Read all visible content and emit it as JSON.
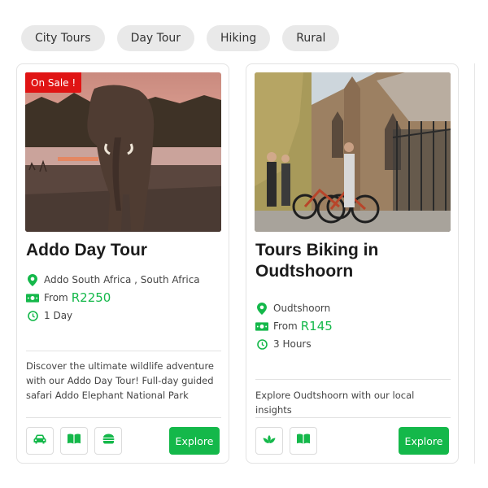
{
  "filters": [
    "City Tours",
    "Day Tour",
    "Hiking",
    "Rural"
  ],
  "colors": {
    "accent": "#14b84a",
    "sale": "#e01414"
  },
  "cards": [
    {
      "badge": "On Sale !",
      "title": "Addo Day Tour",
      "location": "Addo South Africa , South Africa",
      "price_prefix": "From",
      "price": "R2250",
      "duration": "1 Day",
      "description": "Discover the ultimate wildlife adventure with our Addo Day Tour! Full-day guided safari Addo Elephant National Park",
      "amenities": [
        "car-icon",
        "book-icon",
        "burger-icon"
      ],
      "cta": "Explore"
    },
    {
      "title": "Tours Biking in Oudtshoorn",
      "location": "Oudtshoorn",
      "price_prefix": "From",
      "price": "R145",
      "duration": "3 Hours",
      "description": "Explore Oudtshoorn with our local insights",
      "amenities": [
        "lotus-icon",
        "book-icon"
      ],
      "cta": "Explore"
    }
  ]
}
